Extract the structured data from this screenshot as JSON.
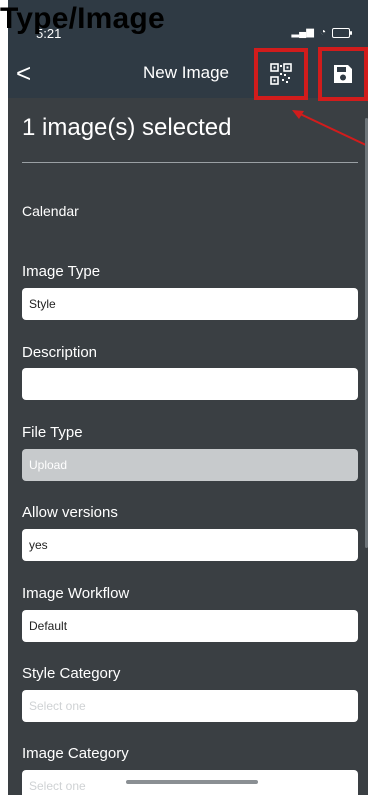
{
  "caption": "Type/Image",
  "status": {
    "time": "5:21"
  },
  "nav": {
    "back_glyph": "<",
    "title": "New Image"
  },
  "selection_heading": "1 image(s) selected",
  "calendar_label": "Calendar",
  "fields": [
    {
      "label": "Image Type",
      "value": "Style",
      "state": "normal"
    },
    {
      "label": "Description",
      "value": "",
      "state": "normal"
    },
    {
      "label": "File Type",
      "value": "Upload",
      "state": "disabled"
    },
    {
      "label": "Allow versions",
      "value": "yes",
      "state": "normal"
    },
    {
      "label": "Image Workflow",
      "value": "Default",
      "state": "normal"
    },
    {
      "label": "Style Category",
      "value": "",
      "placeholder": "Select one",
      "state": "normal"
    },
    {
      "label": "Image Category",
      "value": "",
      "placeholder": "Select one",
      "state": "normal"
    }
  ],
  "colors": {
    "header": "#2f3a44",
    "body": "#3a3f43",
    "highlight": "#d11c1c"
  },
  "icons": {
    "qr": "qr-code-icon",
    "save": "save-icon",
    "back": "chevron-left-icon"
  }
}
